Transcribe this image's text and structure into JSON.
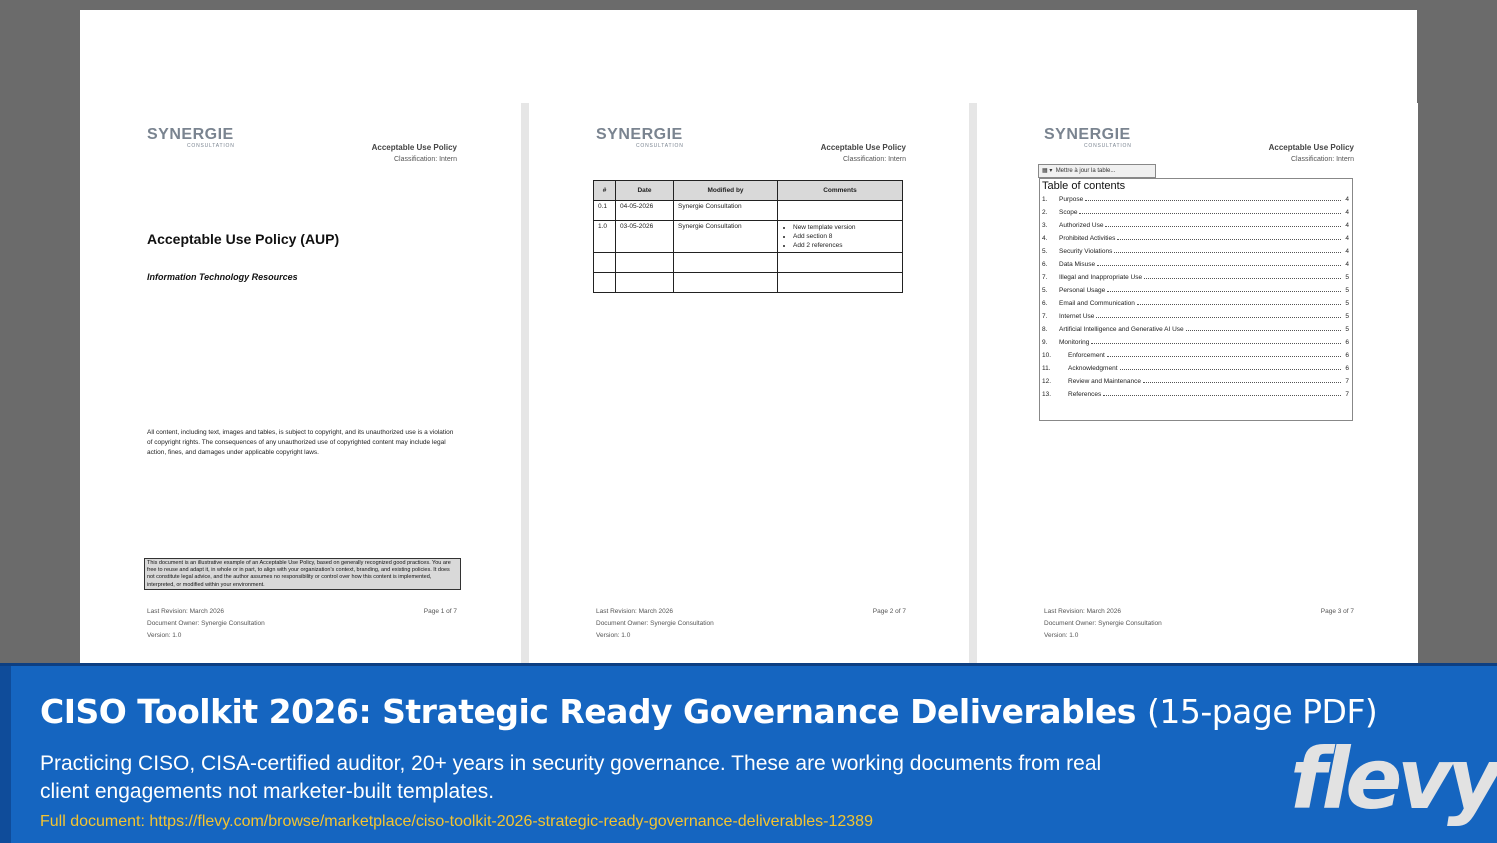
{
  "page1": {
    "logo_main": "SYNERGIE",
    "logo_sub": "CONSULTATION",
    "header_title": "Acceptable Use Policy",
    "header_class": "Classification: Intern",
    "title": "Acceptable Use Policy (AUP)",
    "subtitle": "Information Technology Resources",
    "copyright": "All content, including text, images and tables, is subject to copyright, and its unauthorized use is a violation of copyright rights. The consequences of any unauthorized use of copyrighted content may include legal action, fines, and damages under applicable copyright laws.",
    "disclaimer": "This document is an illustrative example of an Acceptable Use Policy, based on generally recognized good practices. You are free to reuse and adapt it, in whole or in part, to align with your organization's context, branding, and existing policies. It does not constitute legal advice, and the author assumes no responsibility or control over how this content is implemented, interpreted, or modified within your environment.",
    "footer_revision": "Last Revision: March 2026",
    "footer_owner": "Document Owner: Synergie Consultation",
    "footer_version": "Version: 1.0",
    "footer_page": "Page 1 of 7"
  },
  "page2": {
    "logo_main": "SYNERGIE",
    "logo_sub": "CONSULTATION",
    "header_title": "Acceptable Use Policy",
    "header_class": "Classification: Intern",
    "table_headers": [
      "#",
      "Date",
      "Modified by",
      "Comments"
    ],
    "rows": [
      {
        "num": "0.1",
        "date": "04-05-2026",
        "by": "Synergie Consultation",
        "comments": []
      },
      {
        "num": "1.0",
        "date": "03-05-2026",
        "by": "Synergie Consultation",
        "comments": [
          "New template version",
          "Add section 8",
          "Add 2 references"
        ]
      }
    ],
    "footer_revision": "Last Revision: March 2026",
    "footer_owner": "Document Owner: Synergie Consultation",
    "footer_version": "Version: 1.0",
    "footer_page": "Page 2 of 7"
  },
  "page3": {
    "logo_main": "SYNERGIE",
    "logo_sub": "CONSULTATION",
    "header_title": "Acceptable Use Policy",
    "header_class": "Classification: Intern",
    "toc_toolbar": "Mettre à jour la table...",
    "toc_title": "Table of contents",
    "toc": [
      {
        "num": "1.",
        "text": "Purpose",
        "page": "4",
        "sub": false
      },
      {
        "num": "2.",
        "text": "Scope",
        "page": "4",
        "sub": false
      },
      {
        "num": "3.",
        "text": "Authorized Use",
        "page": "4",
        "sub": false
      },
      {
        "num": "4.",
        "text": "Prohibited Activities",
        "page": "4",
        "sub": false
      },
      {
        "num": "5.",
        "text": "Security Violations",
        "page": "4",
        "sub": false
      },
      {
        "num": "6.",
        "text": "Data Misuse",
        "page": "4",
        "sub": false
      },
      {
        "num": "7.",
        "text": "Illegal and Inappropriate Use",
        "page": "5",
        "sub": false
      },
      {
        "num": "5.",
        "text": "Personal Usage",
        "page": "5",
        "sub": false
      },
      {
        "num": "6.",
        "text": "Email and Communication",
        "page": "5",
        "sub": false
      },
      {
        "num": "7.",
        "text": "Internet Use",
        "page": "5",
        "sub": false
      },
      {
        "num": "8.",
        "text": "Artificial Intelligence and Generative AI Use",
        "page": "5",
        "sub": false
      },
      {
        "num": "9.",
        "text": "Monitoring",
        "page": "6",
        "sub": false
      },
      {
        "num": "10.",
        "text": "Enforcement",
        "page": "6",
        "sub": true
      },
      {
        "num": "11.",
        "text": "Acknowledgment",
        "page": "6",
        "sub": true
      },
      {
        "num": "12.",
        "text": "Review and Maintenance",
        "page": "7",
        "sub": true
      },
      {
        "num": "13.",
        "text": "References",
        "page": "7",
        "sub": true
      }
    ],
    "footer_revision": "Last Revision: March 2026",
    "footer_owner": "Document Owner: Synergie Consultation",
    "footer_version": "Version: 1.0",
    "footer_page": "Page 3 of 7"
  },
  "banner": {
    "title": "CISO Toolkit 2026: Strategic Ready Governance Deliverables",
    "title_suffix": "(15-page PDF)",
    "description": "Practicing CISO, CISA-certified auditor, 20+ years in security governance. These are working documents from real client engagements not marketer-built templates.",
    "link": "Full document: https://flevy.com/browse/marketplace/ciso-toolkit-2026-strategic-ready-governance-deliverables-12389",
    "brand": "flevy"
  }
}
